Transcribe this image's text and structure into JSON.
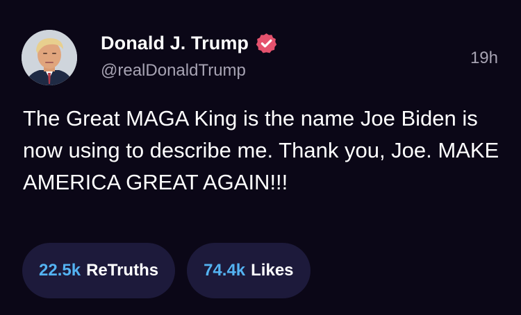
{
  "post": {
    "author": {
      "display_name": "Donald J. Trump",
      "handle": "@realDonaldTrump",
      "verified": true,
      "avatar_icon": "profile-photo"
    },
    "timestamp": "19h",
    "text": "The Great MAGA King is the name Joe Biden is now using to describe me. Thank you, Joe. MAKE AMERICA GREAT AGAIN!!!",
    "stats": {
      "retruths": {
        "count": "22.5k",
        "label": "ReTruths"
      },
      "likes": {
        "count": "74.4k",
        "label": "Likes"
      }
    }
  },
  "colors": {
    "background": "#0b0717",
    "pill_background": "#1d1a3b",
    "accent_count": "#54b3f2",
    "verified_badge": "#e5526e",
    "secondary_text": "#a7a3b3"
  }
}
